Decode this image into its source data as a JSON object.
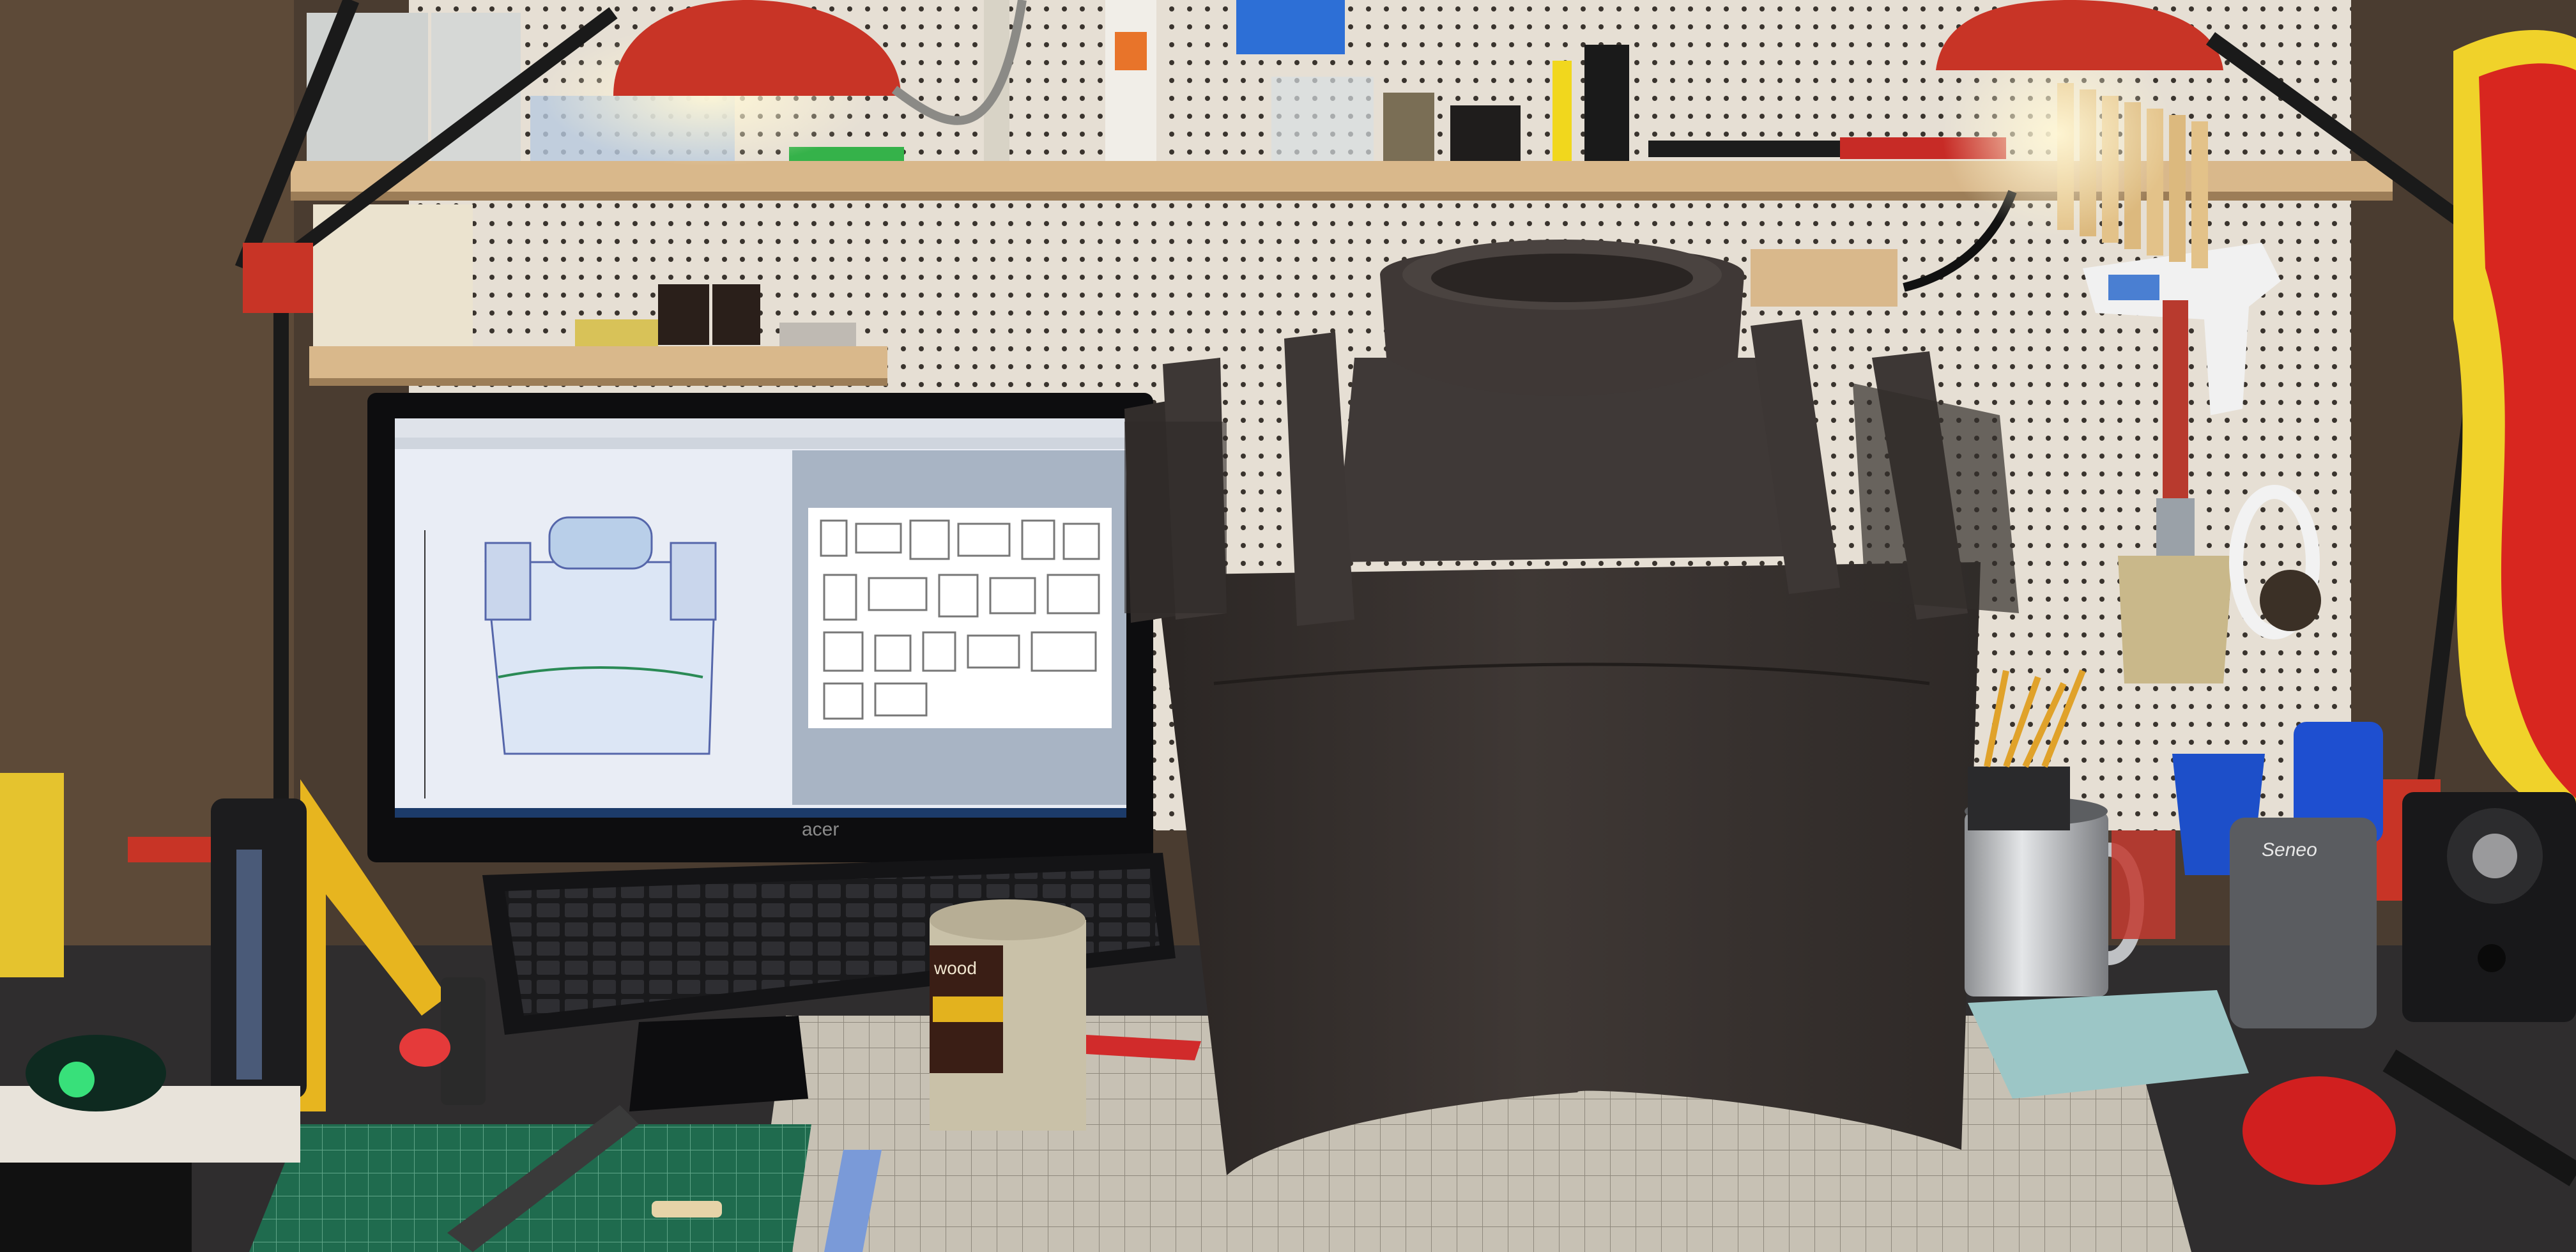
{
  "scene": {
    "subject": "foam-armor-chest-piece",
    "setting": "hobby-workbench"
  },
  "labels": {
    "monitor_brand": "acer",
    "power_bank_brand": "Seneo",
    "can_text": "wood"
  },
  "colors": {
    "pegboard": "#e6dfd4",
    "lamp_shade": "#c83426",
    "foam": "#3b3532",
    "foam_dark": "#2c2725",
    "desk": "#2f2d2e",
    "cutting_mat": "#c7c1b4",
    "green_mat": "#1f6b4e",
    "ruler_yellow": "#e7b51f",
    "boa_red": "#d8261f",
    "boa_yellow": "#f0d22a",
    "screen_bg": "#e9edf5",
    "screen_panel": "#a8b4c4",
    "cup_blue": "#1d4fc9"
  }
}
